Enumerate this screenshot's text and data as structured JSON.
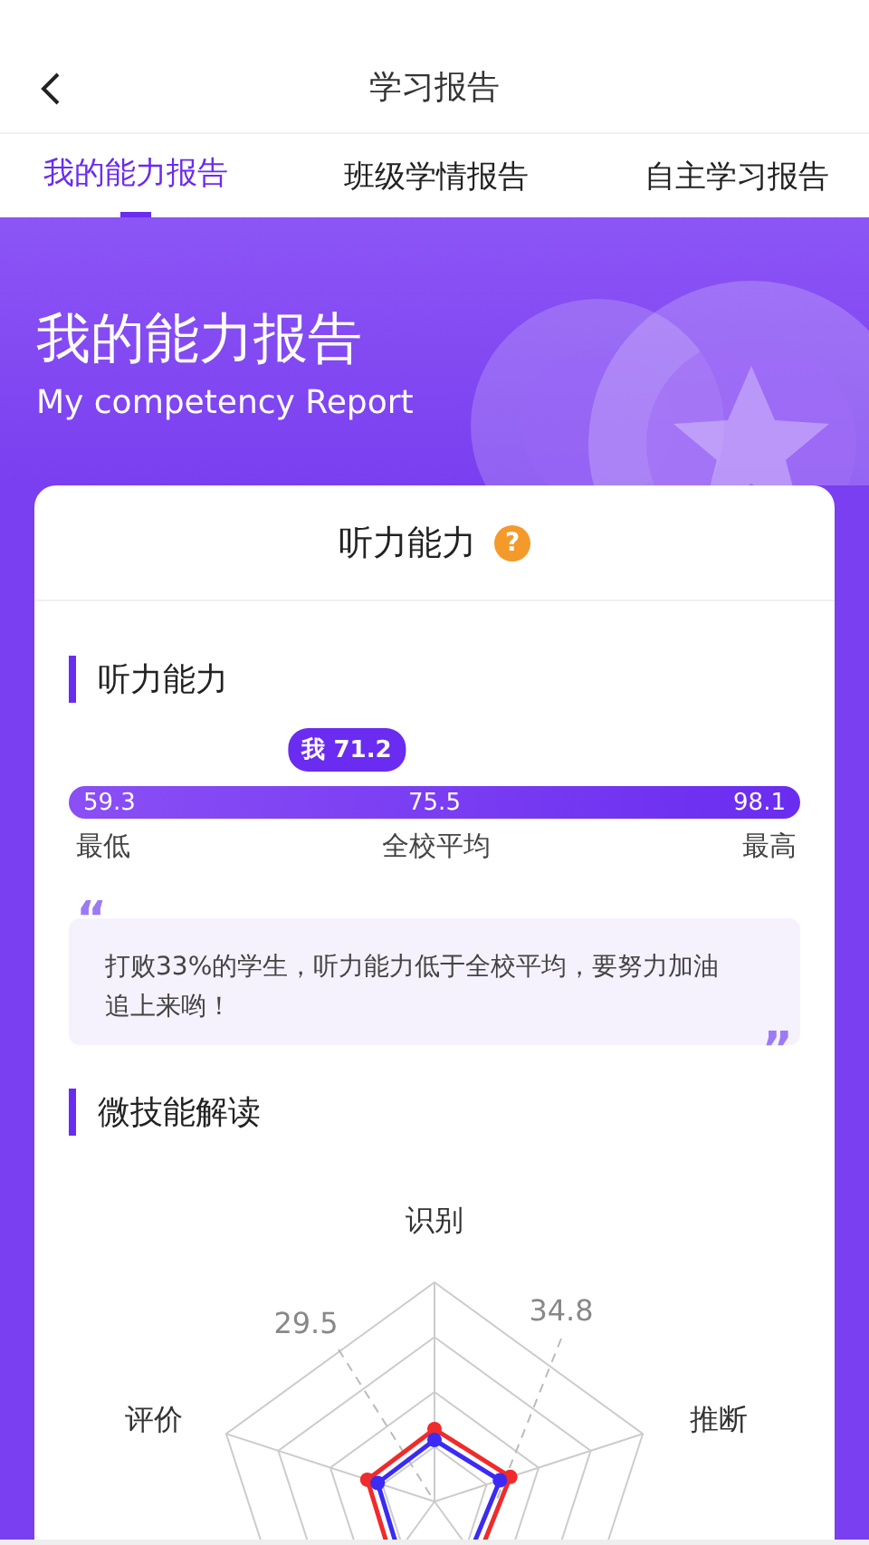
{
  "header": {
    "title": "学习报告"
  },
  "tabs": [
    {
      "label": "我的能力报告",
      "selected": true
    },
    {
      "label": "班级学情报告",
      "selected": false
    },
    {
      "label": "自主学习报告",
      "selected": false
    }
  ],
  "hero": {
    "title": "我的能力报告",
    "subtitle": "My competency Report"
  },
  "card": {
    "title": "听力能力",
    "help_mark": "?"
  },
  "score_section": {
    "heading": "听力能力",
    "my_score": "我 71.2",
    "min_value": "59.3",
    "avg_value": "75.5",
    "max_value": "98.1",
    "min_label": "最低",
    "avg_label": "全校平均",
    "max_label": "最高",
    "open_quote": "“",
    "comment": "打败33%的学生，听力能力低于全校平均，要努力加油追上来哟！",
    "close_quote": "”"
  },
  "skills_section": {
    "heading": "微技能解读",
    "radar": {
      "axis_labels": [
        "识别",
        "推断",
        "评价"
      ],
      "tick_labels": [
        "29.5",
        "34.8"
      ],
      "series": [
        {
          "color": "#f02b2b"
        },
        {
          "color": "#3b2bf5"
        }
      ]
    }
  }
}
